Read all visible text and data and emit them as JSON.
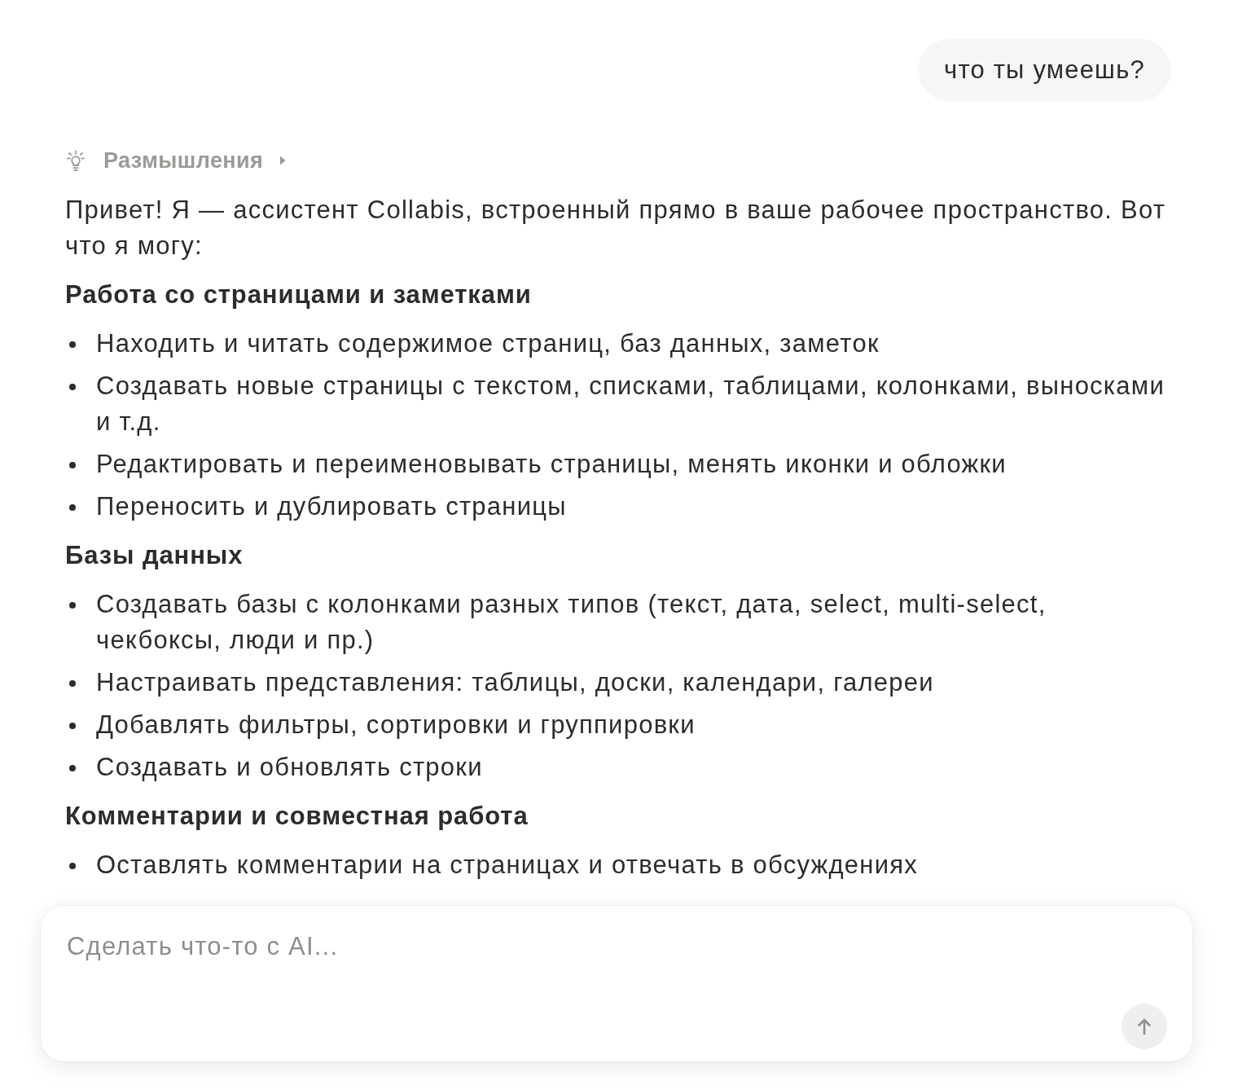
{
  "user_message": {
    "text": "что ты умеешь?"
  },
  "thinking": {
    "label": "Размышления",
    "expanded": false
  },
  "response": {
    "blocks": [
      {
        "kind": "paragraph",
        "text": "Привет! Я — ассистент Collabis, встроенный прямо в ваше рабочее пространство. Вот что я могу:"
      },
      {
        "kind": "heading",
        "text": "Работа со страницами и заметками"
      },
      {
        "kind": "list",
        "items": [
          "Находить и читать содержимое страниц, баз данных, заметок",
          "Создавать новые страницы с текстом, списками, таблицами, колонками, выносками и т.д.",
          "Редактировать и переименовывать страницы, менять иконки и обложки",
          "Переносить и дублировать страницы"
        ]
      },
      {
        "kind": "heading",
        "text": "Базы данных"
      },
      {
        "kind": "list",
        "items": [
          "Создавать базы с колонками разных типов (текст, дата, select, multi-select, чекбоксы, люди и пр.)",
          "Настраивать представления: таблицы, доски, календари, галереи",
          "Добавлять фильтры, сортировки и группировки",
          "Создавать и обновлять строки"
        ]
      },
      {
        "kind": "heading",
        "text": "Комментарии и совместная работа"
      },
      {
        "kind": "list",
        "items": [
          "Оставлять комментарии на страницах и отвечать в обсуждениях"
        ]
      }
    ]
  },
  "composer": {
    "placeholder": "Сделать что-то с AI...",
    "send_button": {
      "disabled": true
    }
  }
}
